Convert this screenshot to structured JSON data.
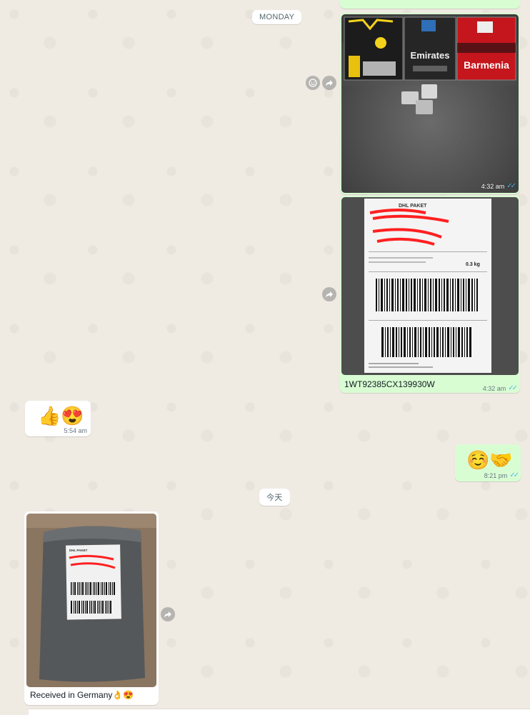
{
  "chat": {
    "date_monday": "MONDAY",
    "date_today": "今天"
  },
  "messages": {
    "jerseys_photo": {
      "time": "4:32 am",
      "status": "read"
    },
    "label_photo": {
      "caption": "1WT92385CX139930W",
      "time": "4:32 am",
      "status": "read",
      "label_text": {
        "carrier": "DHL PAKET",
        "weight": "0.3 kg"
      }
    },
    "reaction_reply": {
      "emojis": "👍😍",
      "time": "5:54 am"
    },
    "handshake_reply": {
      "emojis": "☺️🤝",
      "time": "8:21 pm",
      "status": "read"
    },
    "received_photo": {
      "caption": "Received in Germany👌😍",
      "label_text": {
        "carrier": "DHL PAKET"
      }
    }
  },
  "jersey_prints": [
    "Emirates",
    "Barmenia"
  ],
  "icons": {
    "react": "smiley-icon",
    "forward": "forward-icon",
    "read": "double-check-icon"
  },
  "colors": {
    "background": "#efeae2",
    "outgoing": "#d9fdd3",
    "incoming": "#ffffff",
    "read_ticks": "#53bdeb"
  }
}
